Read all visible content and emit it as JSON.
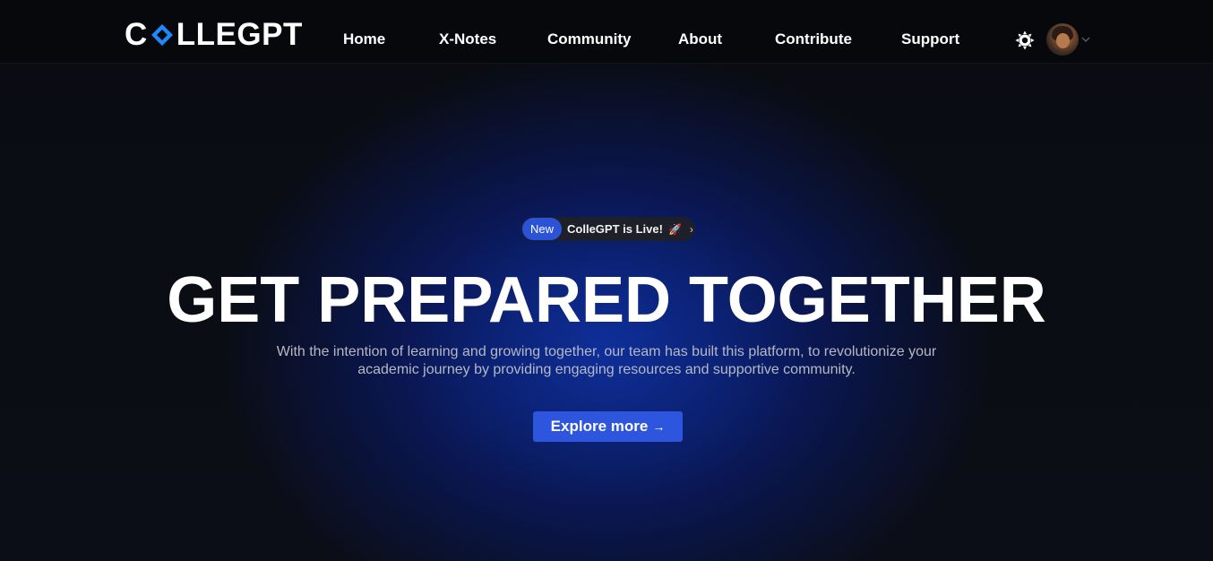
{
  "brand": {
    "logo_left": "C",
    "logo_right": "LLEGPT",
    "logo_full": "COLLEGPT",
    "accent_color": "#1e88ff"
  },
  "nav": {
    "links": [
      {
        "label": "Home"
      },
      {
        "label": "X-Notes"
      },
      {
        "label": "Community"
      },
      {
        "label": "About"
      },
      {
        "label": "Contribute"
      },
      {
        "label": "Support"
      }
    ],
    "theme_toggle_icon": "sun-icon",
    "avatar_icon": "user-avatar",
    "caret_icon": "chevron-down-icon"
  },
  "hero": {
    "badge": {
      "tag": "New",
      "text": "ColleGPT is Live!",
      "rocket": "🚀",
      "chevron": "›"
    },
    "headline": "GET PREPARED TOGETHER",
    "subtext_line1": "With the intention of learning and growing together, our team has built this platform, to revolutionize your",
    "subtext_line2": "academic journey by providing engaging resources and supportive community.",
    "cta": {
      "label": "Explore more",
      "arrow": "→"
    }
  },
  "colors": {
    "navbar_bg": "#07080b",
    "primary_button": "#2d55de",
    "badge_tag": "#2b53d8",
    "glow": "#0f2f9a"
  }
}
